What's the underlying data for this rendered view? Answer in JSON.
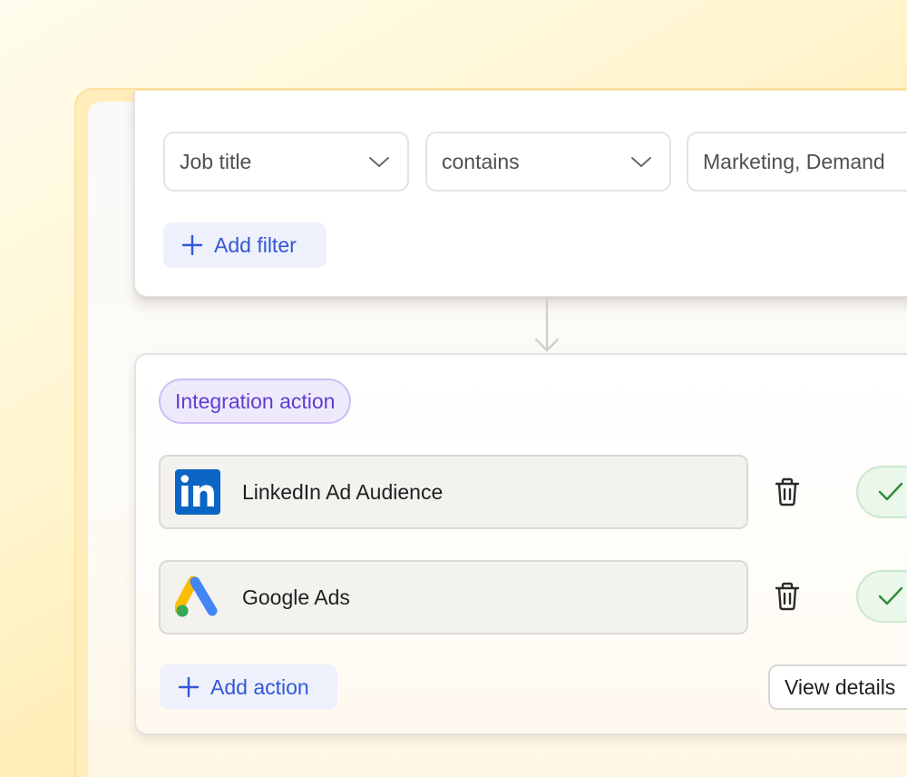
{
  "filters": {
    "field_select": {
      "value": "Job title"
    },
    "operator_select": {
      "value": "contains"
    },
    "value_input": {
      "value": "Marketing, Demand"
    },
    "add_filter_label": "Add filter"
  },
  "actions": {
    "tag_label": "Integration action",
    "integrations": [
      {
        "name": "LinkedIn Ad Audience",
        "icon": "linkedin-logo",
        "status": "enabled"
      },
      {
        "name": "Google Ads",
        "icon": "google-ads-logo",
        "status": "enabled"
      }
    ],
    "add_action_label": "Add action",
    "view_details_label": "View details"
  },
  "colors": {
    "accent_blue": "#3457d5",
    "tag_purple": "#5b3fd1",
    "linkedin_blue": "#0a66c2",
    "success_green": "#2e8b3a",
    "background_yellow": "#fff6d2"
  }
}
